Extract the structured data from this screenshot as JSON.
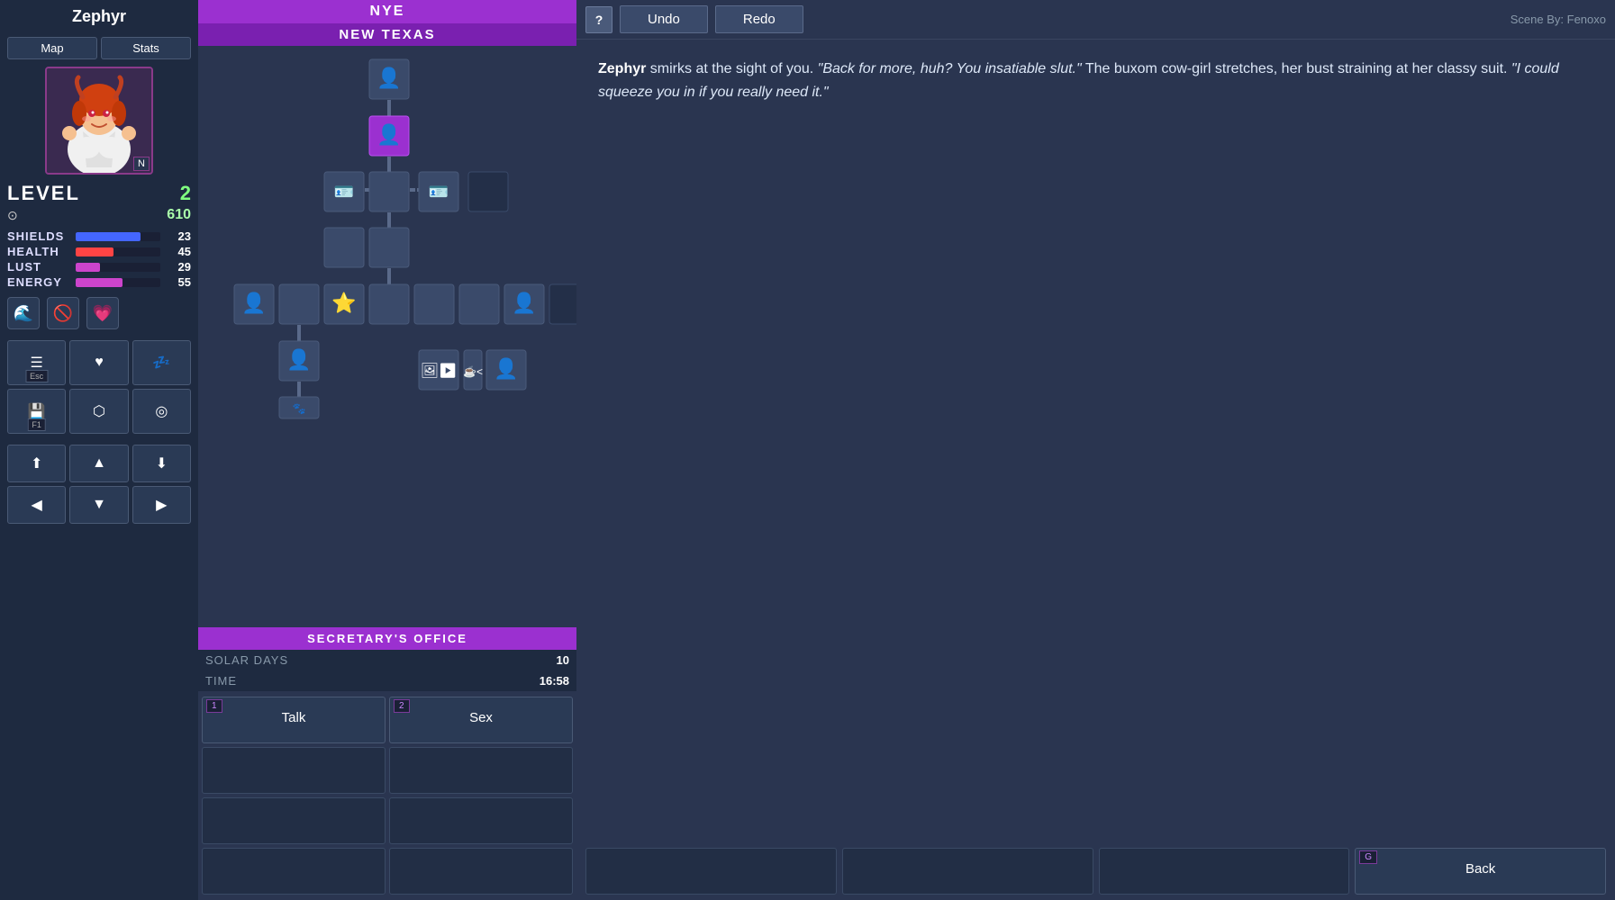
{
  "left": {
    "char_name": "Zephyr",
    "map_btn": "Map",
    "stats_btn": "Stats",
    "level_label": "LEVEL",
    "level_value": "2",
    "credits_value": "610",
    "stats": [
      {
        "label": "SHIELDS",
        "value": "23",
        "max": 30,
        "current": 23,
        "bar_class": "bar-shields"
      },
      {
        "label": "HEALTH",
        "value": "45",
        "max": 100,
        "current": 45,
        "bar_class": "bar-health"
      },
      {
        "label": "LUST",
        "value": "29",
        "max": 100,
        "current": 29,
        "bar_class": "bar-lust"
      },
      {
        "label": "ENERGY",
        "value": "55",
        "max": 100,
        "current": 55,
        "bar_class": "bar-energy"
      }
    ],
    "status_icons": [
      "🌊",
      "🚫",
      "💗"
    ],
    "action_buttons": [
      {
        "icon": "☰",
        "key": "Esc"
      },
      {
        "icon": "♥",
        "key": ""
      },
      {
        "icon": "💤",
        "key": ""
      },
      {
        "icon": "💾",
        "key": "F1"
      },
      {
        "icon": "⬡",
        "key": ""
      },
      {
        "icon": "◎",
        "key": ""
      }
    ],
    "nav_buttons": [
      {
        "icon": "⬆",
        "pos": "up-export"
      },
      {
        "icon": "▲",
        "pos": "up"
      },
      {
        "icon": "⬇",
        "pos": "down-import"
      },
      {
        "icon": "◀",
        "pos": "left"
      },
      {
        "icon": "▼",
        "pos": "down"
      },
      {
        "icon": "▶",
        "pos": "right"
      }
    ]
  },
  "map": {
    "location": "NYE",
    "sublocation": "NEW TEXAS",
    "bottom_label": "SECRETARY'S OFFICE",
    "solar_days_label": "SOLAR DAYS",
    "solar_days_value": "10",
    "time_label": "TIME",
    "time_value": "16:58"
  },
  "choices": [
    {
      "num": "1",
      "label": "Talk",
      "active": true
    },
    {
      "num": "2",
      "label": "Sex",
      "active": true
    },
    {
      "label": "",
      "active": false
    },
    {
      "label": "",
      "active": false
    },
    {
      "label": "",
      "active": false
    },
    {
      "label": "",
      "active": false
    },
    {
      "label": "",
      "active": false
    },
    {
      "label": "",
      "active": false
    }
  ],
  "toolbar": {
    "help_label": "?",
    "undo_label": "Undo",
    "redo_label": "Redo",
    "scene_by": "Scene By: Fenoxo"
  },
  "narrative": {
    "char_name": "Zephyr",
    "text_plain": "smirks at the sight of you. ",
    "text_italic1": "\"Back for more, huh? You insatiable slut.\"",
    "text_plain2": " The buxom cow-girl stretches, her bust straining at her classy suit. ",
    "text_italic2": "\"I could squeeze you in if you really need it.\""
  },
  "right_choices": [
    {
      "label": "",
      "active": false
    },
    {
      "label": "",
      "active": false
    },
    {
      "label": "",
      "active": false
    },
    {
      "g_badge": "G",
      "label": "Back",
      "active": true,
      "is_back": true
    }
  ]
}
